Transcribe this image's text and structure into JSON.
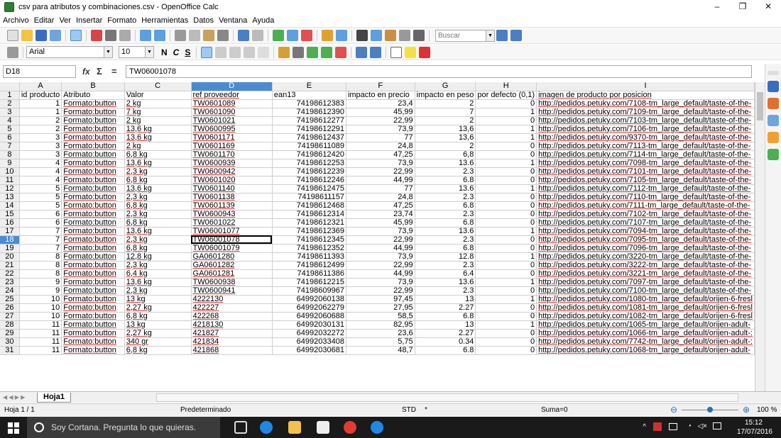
{
  "window": {
    "title": "csv para atributos y combinaciones.csv - OpenOffice Calc",
    "minimize": "–",
    "maximize": "❐",
    "close": "✕"
  },
  "menu": [
    "Archivo",
    "Editar",
    "Ver",
    "Insertar",
    "Formato",
    "Herramientas",
    "Datos",
    "Ventana",
    "Ayuda"
  ],
  "toolbar": {
    "search_placeholder": "Buscar"
  },
  "format_bar": {
    "font_name": "Arial",
    "font_size": "10",
    "bold": "N",
    "italic": "C",
    "underline": "S"
  },
  "formula_bar": {
    "cell_ref": "D18",
    "fx": "fx",
    "sum": "Σ",
    "equals": "=",
    "content": "TW06001078"
  },
  "columns": [
    "A",
    "B",
    "C",
    "D",
    "E",
    "F",
    "G",
    "H",
    "I"
  ],
  "selected_column": "D",
  "selected_row": 18,
  "rows": [
    {
      "n": "1",
      "a": "id producto",
      "b": "Atributo",
      "c": "Valor",
      "d": "ref proveedor",
      "e": "ean13",
      "f": "impacto en precio",
      "g": "impacto en peso",
      "h": "por defecto (0,1)",
      "i": "imagen de producto por posicion"
    },
    {
      "n": "2",
      "a": "1",
      "b": "Formato:button",
      "c": "2 kg",
      "d": "TW0601089",
      "e": "74198612383",
      "f": "23,4",
      "g": "2",
      "h": "0",
      "i": "http://pedidos.petuky.com/7108-tm_large_default/taste-of-the-"
    },
    {
      "n": "3",
      "a": "1",
      "b": "Formato:button",
      "c": "7 kg",
      "d": "TW0601090",
      "e": "74198612390",
      "f": "45,99",
      "g": "7",
      "h": "1",
      "i": "http://pedidos.petuky.com/7109-tm_large_default/taste-of-the-"
    },
    {
      "n": "4",
      "a": "2",
      "b": "Formato:button",
      "c": "2 kg",
      "d": "TW0601021",
      "e": "74198612277",
      "f": "22,99",
      "g": "2",
      "h": "0",
      "i": "http://pedidos.petuky.com/7103-tm_large_default/taste-of-the-"
    },
    {
      "n": "5",
      "a": "2",
      "b": "Formato:button",
      "c": "13,6 kg",
      "d": "TW0600995",
      "e": "74198612291",
      "f": "73,9",
      "g": "13,6",
      "h": "1",
      "i": "http://pedidos.petuky.com/7106-tm_large_default/taste-of-the-"
    },
    {
      "n": "6",
      "a": "3",
      "b": "Formato:button",
      "c": "13,6 kg",
      "d": "TW0601171",
      "e": "74198612437",
      "f": "77",
      "g": "13,6",
      "h": "1",
      "i": "http://pedidos.petuky.com/9370-tm_large_default/taste-of-the-"
    },
    {
      "n": "7",
      "a": "3",
      "b": "Formato:button",
      "c": "2 kg",
      "d": "TW0601169",
      "e": "74198611089",
      "f": "24,8",
      "g": "2",
      "h": "0",
      "i": "http://pedidos.petuky.com/7113-tm_large_default/taste-of-the-"
    },
    {
      "n": "8",
      "a": "3",
      "b": "Formato:button",
      "c": "6,8 kg",
      "d": "TW0601170",
      "e": "74198612420",
      "f": "47,25",
      "g": "6,8",
      "h": "0",
      "i": "http://pedidos.petuky.com/7114-tm_large_default/taste-of-the-"
    },
    {
      "n": "9",
      "a": "4",
      "b": "Formato:button",
      "c": "13,6 kg",
      "d": "TW0600939",
      "e": "74198612253",
      "f": "73,9",
      "g": "13.6",
      "h": "1",
      "i": "http://pedidos.petuky.com/7098-tm_large_default/taste-of-the-"
    },
    {
      "n": "10",
      "a": "4",
      "b": "Formato:button",
      "c": "2,3 kg",
      "d": "TW0600942",
      "e": "74198612239",
      "f": "22,99",
      "g": "2.3",
      "h": "0",
      "i": "http://pedidos.petuky.com/7101-tm_large_default/taste-of-the-"
    },
    {
      "n": "11",
      "a": "4",
      "b": "Formato:button",
      "c": "6,8 kg",
      "d": "TW0601020",
      "e": "74198612246",
      "f": "44,99",
      "g": "6.8",
      "h": "0",
      "i": "http://pedidos.petuky.com/7105-tm_large_default/taste-of-the-"
    },
    {
      "n": "12",
      "a": "5",
      "b": "Formato:button",
      "c": "13,6 kg",
      "d": "TW0601140",
      "e": "74198612475",
      "f": "77",
      "g": "13.6",
      "h": "1",
      "i": "http://pedidos.petuky.com/7112-tm_large_default/taste-of-the-"
    },
    {
      "n": "13",
      "a": "5",
      "b": "Formato:button",
      "c": "2,3 kg",
      "d": "TW0601138",
      "e": "74198611157",
      "f": "24,8",
      "g": "2.3",
      "h": "0",
      "i": "http://pedidos.petuky.com/7110-tm_large_default/taste-of-the-"
    },
    {
      "n": "14",
      "a": "5",
      "b": "Formato:button",
      "c": "6,8 kg",
      "d": "TW0601139",
      "e": "74198612468",
      "f": "47,25",
      "g": "6.8",
      "h": "0",
      "i": "http://pedidos.petuky.com/7111-tm_large_default/taste-of-the-"
    },
    {
      "n": "15",
      "a": "6",
      "b": "Formato:button",
      "c": "2,3 kg",
      "d": "TW0600943",
      "e": "74198612314",
      "f": "23,74",
      "g": "2.3",
      "h": "0",
      "i": "http://pedidos.petuky.com/7102-tm_large_default/taste-of-the-"
    },
    {
      "n": "16",
      "a": "6",
      "b": "Formato:button",
      "c": "6,8 kg",
      "d": "TW0601022",
      "e": "74198612321",
      "f": "45,99",
      "g": "6.8",
      "h": "0",
      "i": "http://pedidos.petuky.com/7107-tm_large_default/taste-of-the-"
    },
    {
      "n": "17",
      "a": "7",
      "b": "Formato:button",
      "c": "13,6 kg",
      "d": "TW06001077",
      "e": "74198612369",
      "f": "73,9",
      "g": "13.6",
      "h": "1",
      "i": "http://pedidos.petuky.com/7094-tm_large_default/taste-of-the-"
    },
    {
      "n": "18",
      "a": "7",
      "b": "Formato:button",
      "c": "2,3 kg",
      "d": "TW06001078",
      "e": "74198612345",
      "f": "22,99",
      "g": "2.3",
      "h": "0",
      "i": "http://pedidos.petuky.com/7095-tm_large_default/taste-of-the-"
    },
    {
      "n": "19",
      "a": "7",
      "b": "Formato:button",
      "c": "6,8 kg",
      "d": "TW06001079",
      "e": "74198612352",
      "f": "44,99",
      "g": "6.8",
      "h": "0",
      "i": "http://pedidos.petuky.com/7096-tm_large_default/taste-of-the-"
    },
    {
      "n": "20",
      "a": "8",
      "b": "Formato:button",
      "c": "12,8 kg",
      "d": "GA0601280",
      "e": "74198611393",
      "f": "73,9",
      "g": "12.8",
      "h": "1",
      "i": "http://pedidos.petuky.com/3220-tm_large_default/taste-of-the-"
    },
    {
      "n": "21",
      "a": "8",
      "b": "Formato:button",
      "c": "2,3 kg",
      "d": "GA0601282",
      "e": "74198612499",
      "f": "22,99",
      "g": "2.3",
      "h": "0",
      "i": "http://pedidos.petuky.com/3222-tm_large_default/taste-of-the-"
    },
    {
      "n": "22",
      "a": "8",
      "b": "Formato:button",
      "c": "6,4 kg",
      "d": "GA0601281",
      "e": "74198611386",
      "f": "44,99",
      "g": "6.4",
      "h": "0",
      "i": "http://pedidos.petuky.com/3221-tm_large_default/taste-of-the-"
    },
    {
      "n": "23",
      "a": "9",
      "b": "Formato:button",
      "c": "13,6 kg",
      "d": "TW0600938",
      "e": "74198612215",
      "f": "73,9",
      "g": "13.6",
      "h": "1",
      "i": "http://pedidos.petuky.com/7097-tm_large_default/taste-of-the-"
    },
    {
      "n": "24",
      "a": "9",
      "b": "Formato:button",
      "c": "2,3 kg",
      "d": "TW0600941",
      "e": "74198609967",
      "f": "22,99",
      "g": "2.3",
      "h": "0",
      "i": "http://pedidos.petuky.com/7100-tm_large_default/taste-of-the-"
    },
    {
      "n": "25",
      "a": "10",
      "b": "Formato:button",
      "c": "13 kg",
      "d": "4222130",
      "e": "64992060138",
      "f": "97,45",
      "g": "13",
      "h": "1",
      "i": "http://pedidos.petuky.com/1080-tm_large_default/orijen-6-fresl"
    },
    {
      "n": "26",
      "a": "10",
      "b": "Formato:button",
      "c": "2,27 kg",
      "d": "422227",
      "e": "64992062279",
      "f": "27,95",
      "g": "2.27",
      "h": "0",
      "i": "http://pedidos.petuky.com/1081-tm_large_default/orijen-6-fresl"
    },
    {
      "n": "27",
      "a": "10",
      "b": "Formato:button",
      "c": "6,8 kg",
      "d": "422268",
      "e": "64992060688",
      "f": "58,5",
      "g": "6.8",
      "h": "0",
      "i": "http://pedidos.petuky.com/1082-tm_large_default/orijen-6-fresl"
    },
    {
      "n": "28",
      "a": "11",
      "b": "Formato:button",
      "c": "13 kg",
      "d": "4218130",
      "e": "64992030131",
      "f": "82,95",
      "g": "13",
      "h": "1",
      "i": "http://pedidos.petuky.com/1065-tm_large_default/orijen-adult-"
    },
    {
      "n": "29",
      "a": "11",
      "b": "Formato:button",
      "c": "2,27 kg",
      "d": "421827",
      "e": "64992032272",
      "f": "23,6",
      "g": "2.27",
      "h": "0",
      "i": "http://pedidos.petuky.com/1066-tm_large_default/orijen-adult-:"
    },
    {
      "n": "30",
      "a": "11",
      "b": "Formato:button",
      "c": "340 gr",
      "d": "421834",
      "e": "64992033408",
      "f": "5,75",
      "g": "0.34",
      "h": "0",
      "i": "http://pedidos.petuky.com/7742-tm_large_default/orijen-adult-:"
    },
    {
      "n": "31",
      "a": "11",
      "b": "Formato:button",
      "c": "6,8 kg",
      "d": "421868",
      "e": "64992030681",
      "f": "48,7",
      "g": "6.8",
      "h": "0",
      "i": "http://pedidos.petuky.com/1068-tm_large_default/orijen-adult-"
    }
  ],
  "sheet_tab": "Hoja1",
  "status": {
    "sheet": "Hoja 1 / 1",
    "style": "Predeterminado",
    "mode": "STD",
    "star": "*",
    "sum": "Suma=0",
    "zoom_level": "100 %",
    "zoom_minus": "⊖",
    "zoom_plus": "⊕"
  },
  "taskbar": {
    "search_text": "Soy Cortana. Pregunta lo que quieras.",
    "time": "15:12",
    "date": "17/07/2016"
  },
  "colors": {
    "selection": "#4b8bd2",
    "taskbar": "#1a1a1a"
  }
}
